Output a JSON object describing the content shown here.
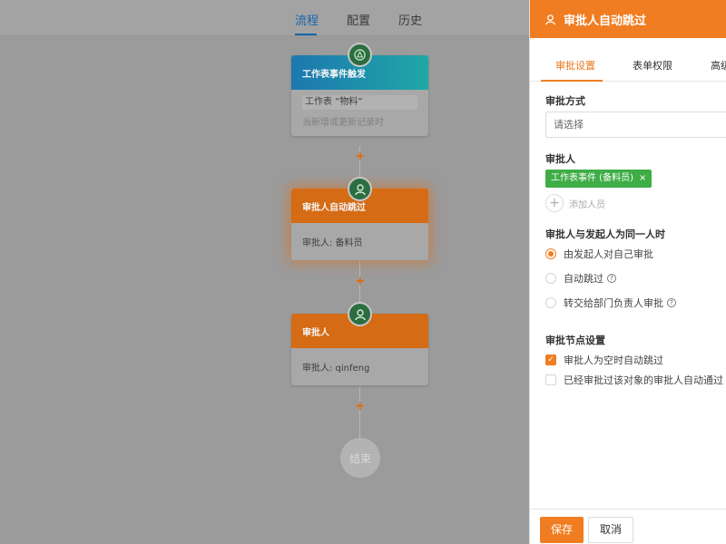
{
  "topbar": {
    "tabs": [
      {
        "label": "流程",
        "active": true
      },
      {
        "label": "配置",
        "active": false
      },
      {
        "label": "历史",
        "active": false
      }
    ]
  },
  "canvas": {
    "nodes": [
      {
        "title": "工作表事件触发",
        "line1": "工作表 “物料”",
        "line2": "当新增或更新记录时",
        "icon": "trigger-icon"
      },
      {
        "title": "审批人自动跳过",
        "line1": "审批人: 备料员",
        "icon": "user-icon"
      },
      {
        "title": "审批人",
        "line1": "审批人: qinfeng",
        "icon": "user-icon"
      }
    ],
    "plus": "+",
    "end_label": "结束"
  },
  "panel": {
    "title": "审批人自动跳过",
    "tabs": [
      "审批设置",
      "表单权限",
      "高级"
    ],
    "approval_method": {
      "title": "审批方式",
      "placeholder": "请选择"
    },
    "approver": {
      "title": "审批人",
      "tag": "工作表事件 (备料员)",
      "tag_close": "×",
      "add_label": "添加人员"
    },
    "same_person": {
      "title": "审批人与发起人为同一人时",
      "options": [
        {
          "label": "由发起人对自己审批",
          "selected": true
        },
        {
          "label": "自动跳过",
          "selected": false,
          "help": true
        },
        {
          "label": "转交给部门负责人审批",
          "selected": false,
          "help": true
        }
      ]
    },
    "node_settings": {
      "title": "审批节点设置",
      "checks": [
        {
          "label": "审批人为空时自动跳过",
          "checked": true
        },
        {
          "label": "已经审批过该对象的审批人自动通过",
          "checked": false
        }
      ]
    },
    "footer": {
      "save": "保存",
      "cancel": "取消"
    }
  },
  "colors": {
    "accent": "#f07d21",
    "tab_active": "#1565a8",
    "tag_green": "#3fad46",
    "node_icon": "#2c6e3f"
  }
}
